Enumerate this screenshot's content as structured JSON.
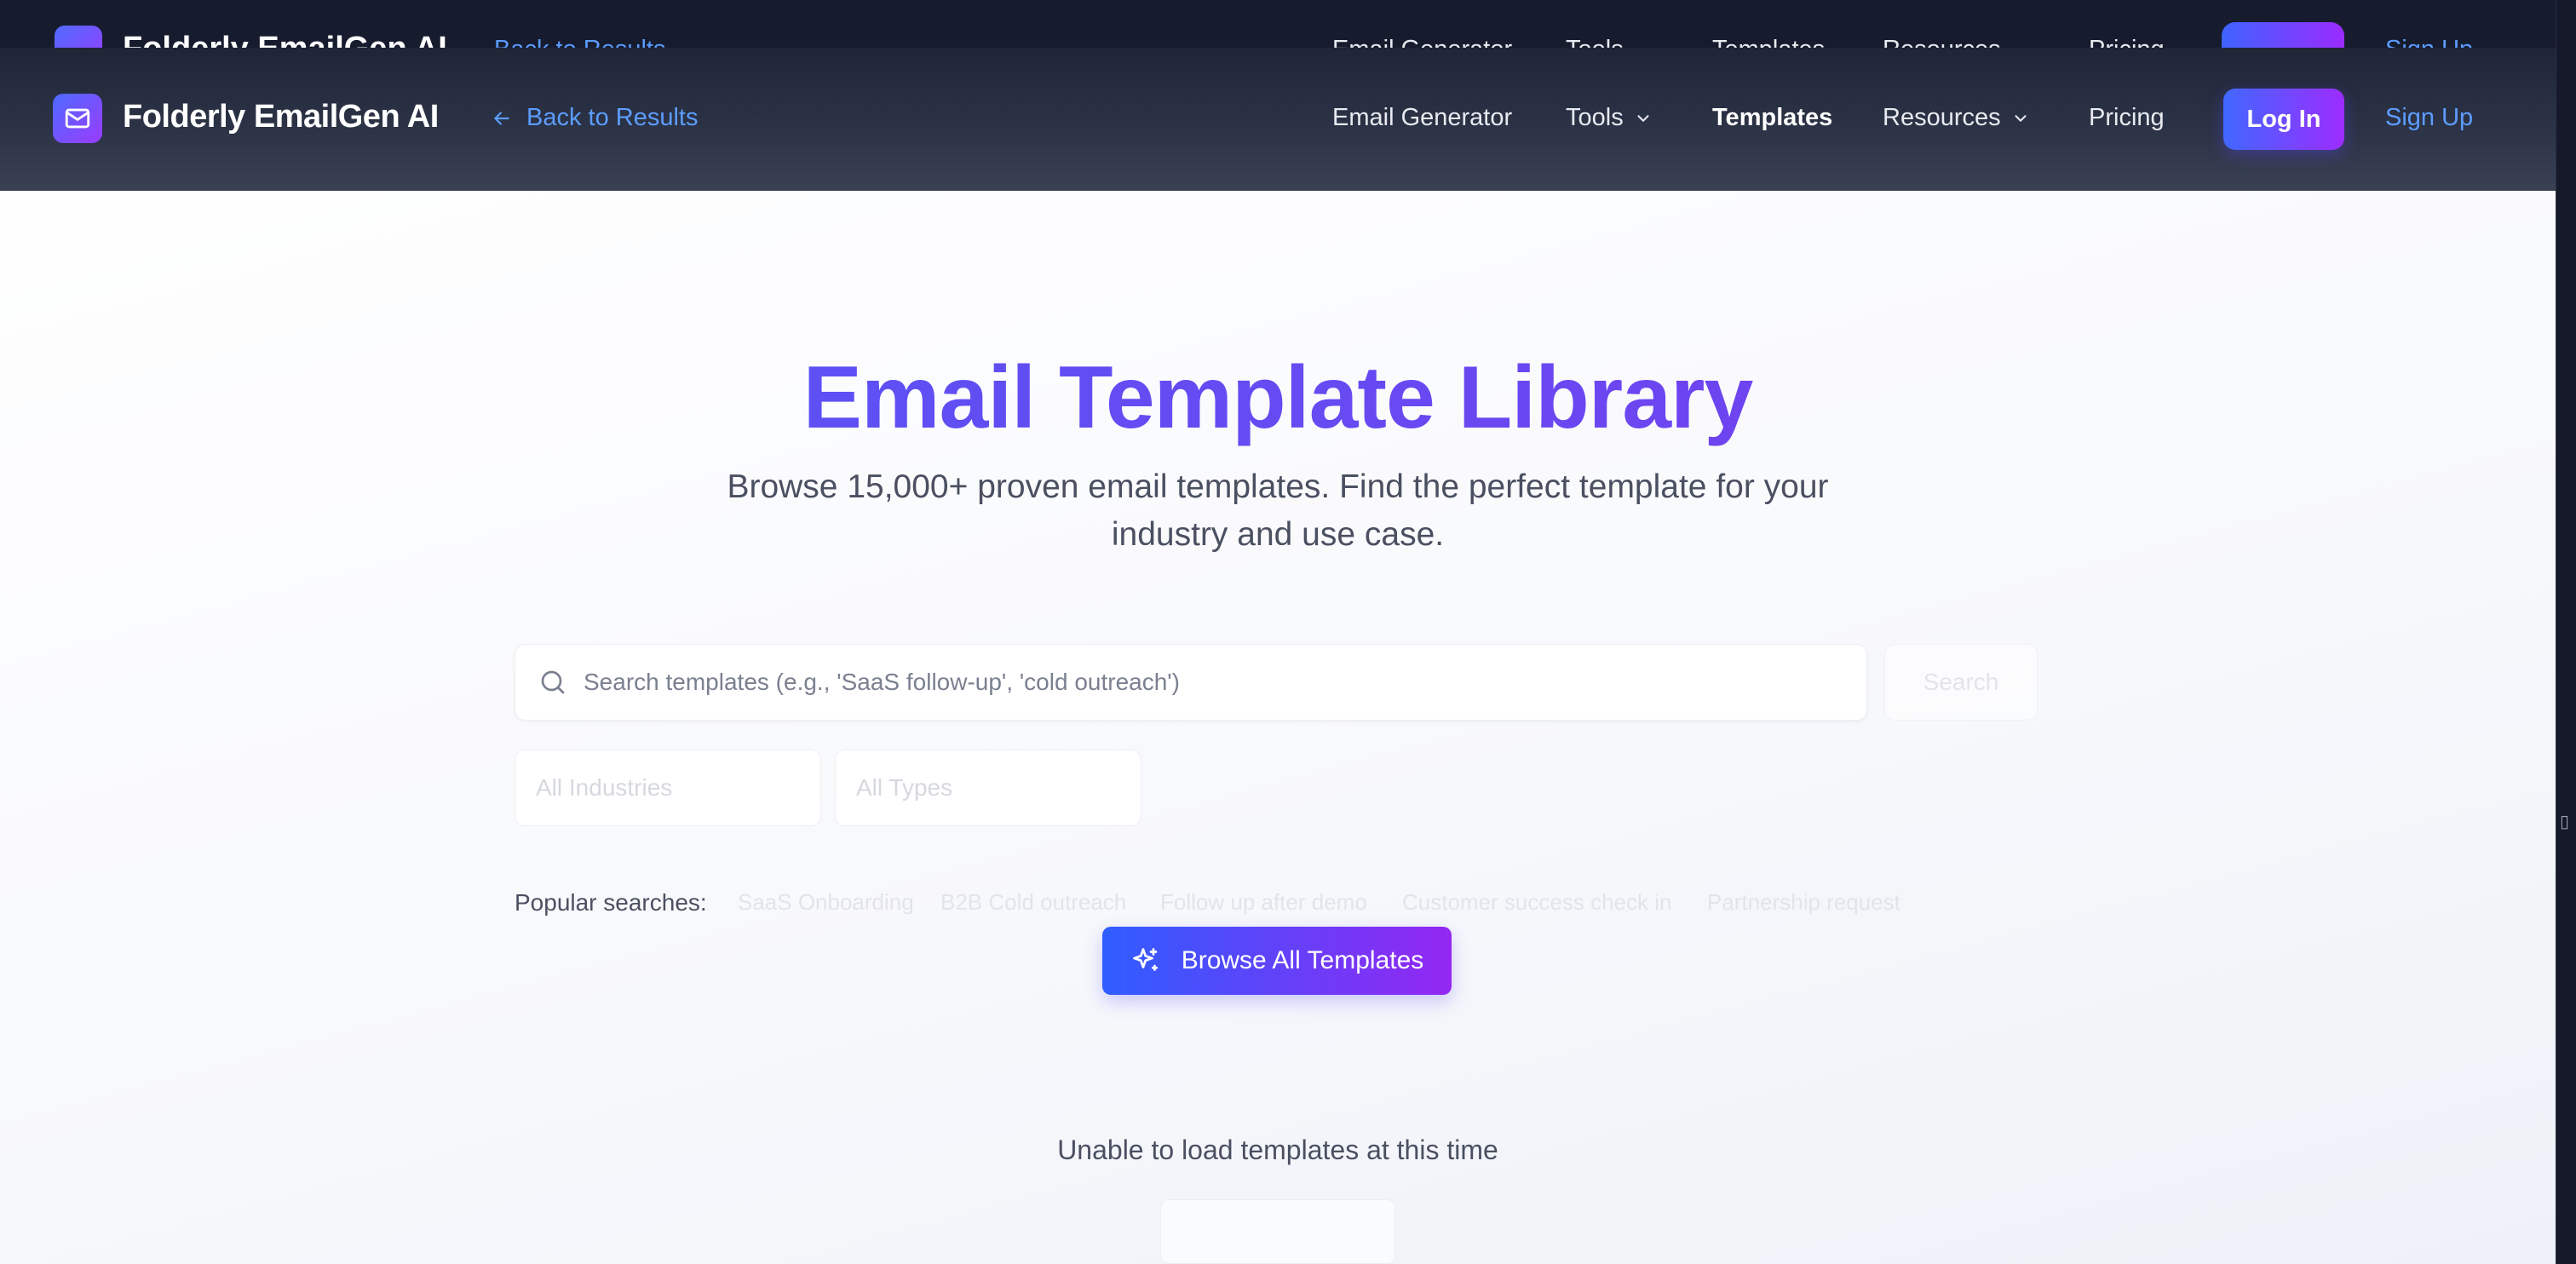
{
  "app": {
    "brand": "Folderly EmailGen AI",
    "back_label": "Back to Results"
  },
  "nav": {
    "items": [
      {
        "label": "Email Generator",
        "dropdown": false,
        "active": false
      },
      {
        "label": "Tools",
        "dropdown": true,
        "active": false
      },
      {
        "label": "Templates",
        "dropdown": false,
        "active": true
      },
      {
        "label": "Resources",
        "dropdown": true,
        "active": false
      },
      {
        "label": "Pricing",
        "dropdown": false,
        "active": false
      }
    ],
    "login_label": "Log In",
    "signup_label": "Sign Up"
  },
  "hero": {
    "title": "Email Template Library",
    "subtitle": "Browse 15,000+ proven email templates. Find the perfect template for your industry and use case."
  },
  "search": {
    "placeholder": "Search templates (e.g., 'SaaS follow-up', 'cold outreach')",
    "value": "",
    "search_button_label": "Search"
  },
  "filters": {
    "industry_selected": "All Industries",
    "type_selected": "All Types"
  },
  "popular": {
    "label": "Popular searches:",
    "chips": [
      "SaaS Onboarding",
      "B2B Cold outreach",
      "Follow up after demo",
      "Customer success check in",
      "Partnership request"
    ]
  },
  "actions": {
    "browse_all_label": "Browse All Templates"
  },
  "status": {
    "message": "Unable to load templates at this time"
  },
  "colors": {
    "accent_blue": "#4068ff",
    "accent_purple": "#9d2cff",
    "link": "#5c9dff",
    "nav_bg": "#2d3447"
  },
  "icons": {
    "logo": "mail-icon",
    "back": "arrow-left-icon",
    "dropdown": "chevron-down-icon",
    "search": "search-icon",
    "browse": "sparkles-icon"
  }
}
